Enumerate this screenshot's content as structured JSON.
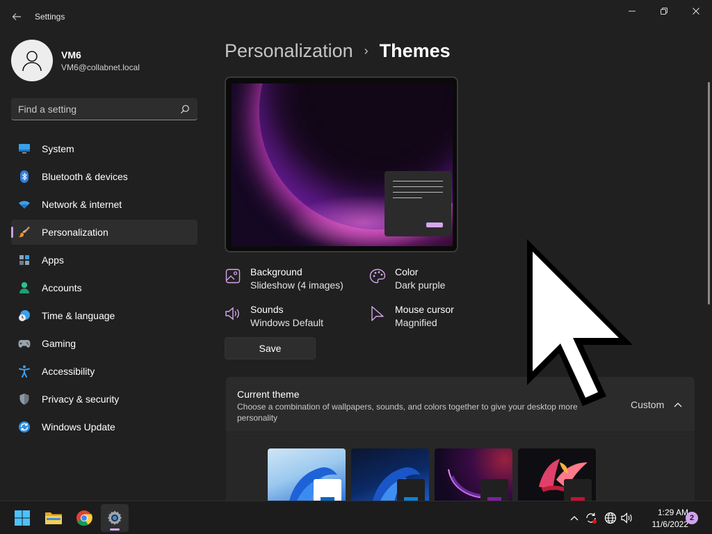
{
  "window": {
    "title": "Settings",
    "back_icon": "arrow-left-icon",
    "controls": [
      "minimize-icon",
      "restore-icon",
      "close-icon"
    ]
  },
  "profile": {
    "name": "VM6",
    "email": "VM6@collabnet.local",
    "avatar_icon": "person-icon"
  },
  "search": {
    "placeholder": "Find a setting",
    "icon": "search-icon"
  },
  "sidebar": {
    "active_index": 3,
    "items": [
      {
        "label": "System",
        "icon": "monitor-icon"
      },
      {
        "label": "Bluetooth & devices",
        "icon": "bluetooth-icon"
      },
      {
        "label": "Network & internet",
        "icon": "wifi-icon"
      },
      {
        "label": "Personalization",
        "icon": "brush-icon"
      },
      {
        "label": "Apps",
        "icon": "apps-icon"
      },
      {
        "label": "Accounts",
        "icon": "account-icon"
      },
      {
        "label": "Time & language",
        "icon": "clock-globe-icon"
      },
      {
        "label": "Gaming",
        "icon": "gamepad-icon"
      },
      {
        "label": "Accessibility",
        "icon": "accessibility-icon"
      },
      {
        "label": "Privacy & security",
        "icon": "shield-icon"
      },
      {
        "label": "Windows Update",
        "icon": "update-icon"
      }
    ]
  },
  "breadcrumb": {
    "parent": "Personalization",
    "separator": "›",
    "current": "Themes"
  },
  "theme_props": {
    "background": {
      "title": "Background",
      "value": "Slideshow (4 images)",
      "icon": "image-icon"
    },
    "color": {
      "title": "Color",
      "value": "Dark purple",
      "icon": "palette-icon"
    },
    "sounds": {
      "title": "Sounds",
      "value": "Windows Default",
      "icon": "speaker-icon"
    },
    "cursor": {
      "title": "Mouse cursor",
      "value": "Magnified",
      "icon": "cursor-icon"
    }
  },
  "save_label": "Save",
  "current_theme": {
    "title": "Current theme",
    "description": "Choose a combination of wallpapers, sounds, and colors together to give your desktop more personality",
    "value": "Custom",
    "expanded": true
  },
  "theme_thumbnails": [
    {
      "name": "windows-light",
      "mini_color": "#ffffff",
      "btn_color": "#0067c0"
    },
    {
      "name": "windows-dark",
      "mini_color": "#202020",
      "btn_color": "#0a84d6"
    },
    {
      "name": "glow",
      "mini_color": "#202020",
      "btn_color": "#7a1fa2"
    },
    {
      "name": "captured-motion",
      "mini_color": "#202020",
      "btn_color": "#c8102e"
    }
  ],
  "accent_color": "#c99ee6",
  "taskbar": {
    "apps": [
      {
        "name": "start",
        "icon": "windows-logo-icon"
      },
      {
        "name": "file-explorer",
        "icon": "folder-icon"
      },
      {
        "name": "chrome",
        "icon": "chrome-icon"
      },
      {
        "name": "settings",
        "icon": "gear-icon",
        "active": true
      }
    ],
    "tray_icons": [
      "chevron-up-icon",
      "sync-icon",
      "globe-icon",
      "volume-icon"
    ],
    "time": "1:29 AM",
    "date": "11/6/2022",
    "notification_count": "2"
  }
}
